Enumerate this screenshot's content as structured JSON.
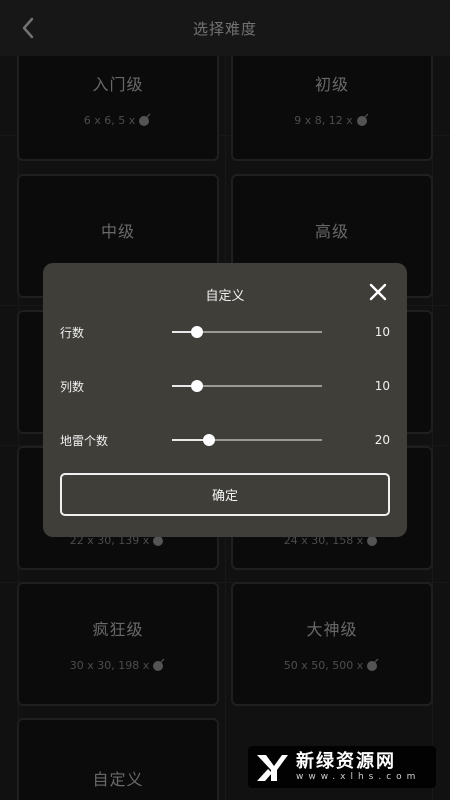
{
  "header": {
    "title": "选择难度",
    "back_icon": "chevron-left-icon"
  },
  "levels": [
    {
      "name": "入门级",
      "detail": "6 x 6,  5 x"
    },
    {
      "name": "初级",
      "detail": "9 x 8,  12 x"
    },
    {
      "name": "中级",
      "detail": ""
    },
    {
      "name": "高级",
      "detail": ""
    },
    {
      "name": "",
      "detail": ""
    },
    {
      "name": "",
      "detail": ""
    },
    {
      "name": "",
      "detail": "22 x 30,  139 x"
    },
    {
      "name": "",
      "detail": "24 x 30,  158 x"
    },
    {
      "name": "疯狂级",
      "detail": "30 x 30,  198 x"
    },
    {
      "name": "大神级",
      "detail": "50 x 50,  500 x"
    },
    {
      "name": "自定义",
      "detail": ""
    }
  ],
  "dialog": {
    "title": "自定义",
    "close_icon": "close-icon",
    "rows": [
      {
        "label": "行数",
        "value": "10",
        "fraction": 0.1
      },
      {
        "label": "列数",
        "value": "10",
        "fraction": 0.1
      },
      {
        "label": "地雷个数",
        "value": "20",
        "fraction": 0.2
      }
    ],
    "confirm_label": "确定"
  },
  "watermark": {
    "text": "新绿资源网",
    "sub": "www.xlhs.com"
  },
  "colors": {
    "background": "#1f1f1f",
    "dialog": "#3f3e39",
    "card": "#151515"
  }
}
